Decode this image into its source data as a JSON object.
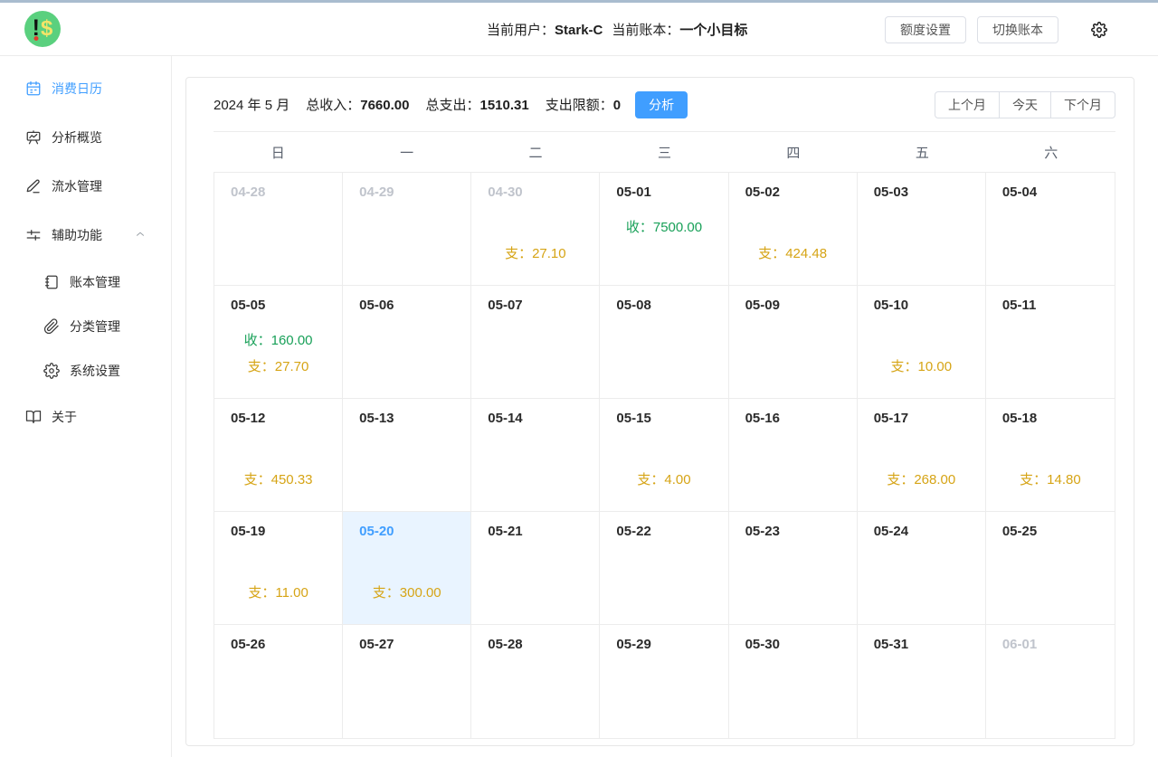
{
  "colors": {
    "accent_blue": "#409eff",
    "today_bg": "#e9f4ff",
    "income_green": "#18a058",
    "expense_gold": "#d6a415",
    "muted_date": "#c0c4cc",
    "logo_bg": "#5ad07e",
    "logo_dollar": "#f3e468",
    "top_strip": "#a9bccf"
  },
  "header": {
    "user_label": "当前用户：",
    "user_value": "Stark-C",
    "ledger_label": "当前账本：",
    "ledger_value": "一个小目标",
    "quota_button": "额度设置",
    "switch_ledger_button": "切换账本",
    "gear_icon": "gear-icon"
  },
  "sidebar": {
    "items": [
      {
        "label": "消费日历",
        "icon": "calendar-icon",
        "active": true
      },
      {
        "label": "分析概览",
        "icon": "presentation-chart-icon"
      },
      {
        "label": "流水管理",
        "icon": "pen-icon"
      },
      {
        "label": "辅助功能",
        "icon": "sliders-icon",
        "expanded": true
      },
      {
        "label": "账本管理",
        "icon": "notebook-icon",
        "sub": true
      },
      {
        "label": "分类管理",
        "icon": "paperclip-icon",
        "sub": true
      },
      {
        "label": "系统设置",
        "icon": "gear-icon",
        "sub": true
      },
      {
        "label": "关于",
        "icon": "open-book-icon"
      }
    ]
  },
  "calendar": {
    "title": {
      "year_month": "2024 年 5 月",
      "income_label": "总收入：",
      "income_value": "7660.00",
      "expense_label": "总支出：",
      "expense_value": "1510.31",
      "limit_label": "支出限额：",
      "limit_value": "0",
      "analyze_button": "分析"
    },
    "nav": {
      "prev": "上个月",
      "today": "今天",
      "next": "下个月"
    },
    "weekdays": [
      "日",
      "一",
      "二",
      "三",
      "四",
      "五",
      "六"
    ],
    "income_prefix": "收：",
    "expense_prefix": "支：",
    "cells": [
      {
        "date": "04-28",
        "other": true
      },
      {
        "date": "04-29",
        "other": true
      },
      {
        "date": "04-30",
        "other": true,
        "expense": "27.10"
      },
      {
        "date": "05-01",
        "income": "7500.00"
      },
      {
        "date": "05-02",
        "expense": "424.48"
      },
      {
        "date": "05-03"
      },
      {
        "date": "05-04"
      },
      {
        "date": "05-05",
        "income": "160.00",
        "expense": "27.70"
      },
      {
        "date": "05-06"
      },
      {
        "date": "05-07"
      },
      {
        "date": "05-08"
      },
      {
        "date": "05-09"
      },
      {
        "date": "05-10",
        "expense": "10.00"
      },
      {
        "date": "05-11"
      },
      {
        "date": "05-12",
        "expense": "450.33"
      },
      {
        "date": "05-13"
      },
      {
        "date": "05-14"
      },
      {
        "date": "05-15",
        "expense": "4.00"
      },
      {
        "date": "05-16"
      },
      {
        "date": "05-17",
        "expense": "268.00"
      },
      {
        "date": "05-18",
        "expense": "14.80"
      },
      {
        "date": "05-19",
        "expense": "11.00"
      },
      {
        "date": "05-20",
        "today": true,
        "expense": "300.00"
      },
      {
        "date": "05-21"
      },
      {
        "date": "05-22"
      },
      {
        "date": "05-23"
      },
      {
        "date": "05-24"
      },
      {
        "date": "05-25"
      },
      {
        "date": "05-26"
      },
      {
        "date": "05-27"
      },
      {
        "date": "05-28"
      },
      {
        "date": "05-29"
      },
      {
        "date": "05-30"
      },
      {
        "date": "05-31"
      },
      {
        "date": "06-01",
        "other": true
      }
    ]
  }
}
